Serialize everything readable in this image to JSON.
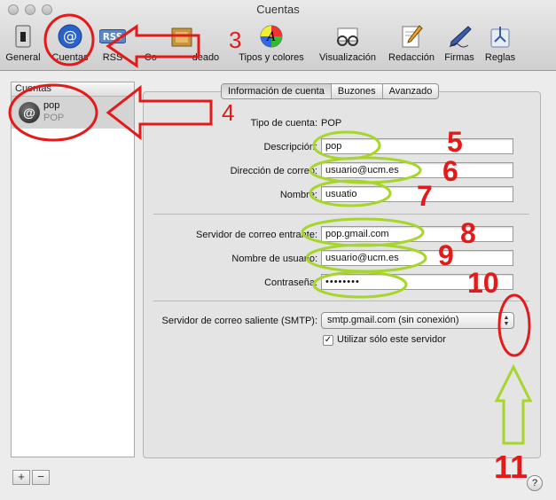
{
  "window": {
    "title": "Cuentas"
  },
  "toolbar": {
    "items": [
      {
        "label": "General",
        "icon": "switch-icon"
      },
      {
        "label": "Cuentas",
        "icon": "at-sign-icon"
      },
      {
        "label": "RSS",
        "icon": "rss-icon"
      },
      {
        "label": "Correo basura",
        "icon": "junk-mail-icon",
        "visible_text": "Co             deado"
      },
      {
        "label": "Tipos y colores",
        "icon": "color-wheel-icon"
      },
      {
        "label": "Visualización",
        "icon": "glasses-icon"
      },
      {
        "label": "Redacción",
        "icon": "pencil-icon"
      },
      {
        "label": "Firmas",
        "icon": "pen-icon"
      },
      {
        "label": "Reglas",
        "icon": "rules-icon"
      }
    ]
  },
  "sidebar": {
    "header": "Cuentas",
    "account": {
      "name": "pop",
      "type": "POP"
    }
  },
  "tabs": [
    "Información de cuenta",
    "Buzones",
    "Avanzado"
  ],
  "form": {
    "account_type_label": "Tipo de cuenta:",
    "account_type_value": "POP",
    "description_label": "Descripción:",
    "description_value": "pop",
    "email_label": "Dirección de correo:",
    "email_value": "usuario@ucm.es",
    "name_label": "Nombre:",
    "name_value": "usuatio",
    "incoming_label": "Servidor de correo entrante:",
    "incoming_value": "pop.gmail.com",
    "username_label": "Nombre de usuario:",
    "username_value": "usuario@ucm.es",
    "password_label": "Contraseña:",
    "password_value": "••••••••",
    "smtp_label": "Servidor de correo saliente (SMTP):",
    "smtp_value": "smtp.gmail.com (sin conexión)",
    "only_server_label": "Utilizar sólo este servidor",
    "only_server_checked": "✓"
  },
  "buttons": {
    "add": "+",
    "remove": "−",
    "help": "?"
  },
  "annotations": [
    "3",
    "4",
    "5",
    "6",
    "7",
    "8",
    "9",
    "10",
    "11"
  ],
  "colors": {
    "annotation_red": "#e41a1a",
    "annotation_green": "#a6d62a"
  }
}
